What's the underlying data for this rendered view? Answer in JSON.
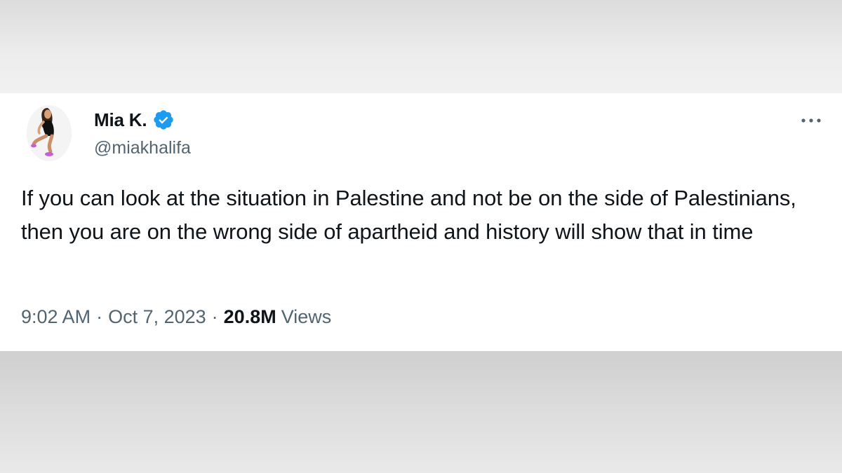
{
  "tweet": {
    "display_name": "Mia K.",
    "handle": "@miakhalifa",
    "verified_icon": "verified-badge-icon",
    "more_icon": "more-options-icon",
    "text": "If you can look at the situation in Palestine and not be on the side of Palestinians, then you are on the wrong side of apartheid and history will show that in time",
    "time": "9:02 AM",
    "separator": "·",
    "date": "Oct 7, 2023",
    "views_count": "20.8M",
    "views_label": "Views"
  },
  "colors": {
    "verified_blue": "#1d9bf0",
    "text_primary": "#0f1419",
    "text_secondary": "#536471"
  }
}
